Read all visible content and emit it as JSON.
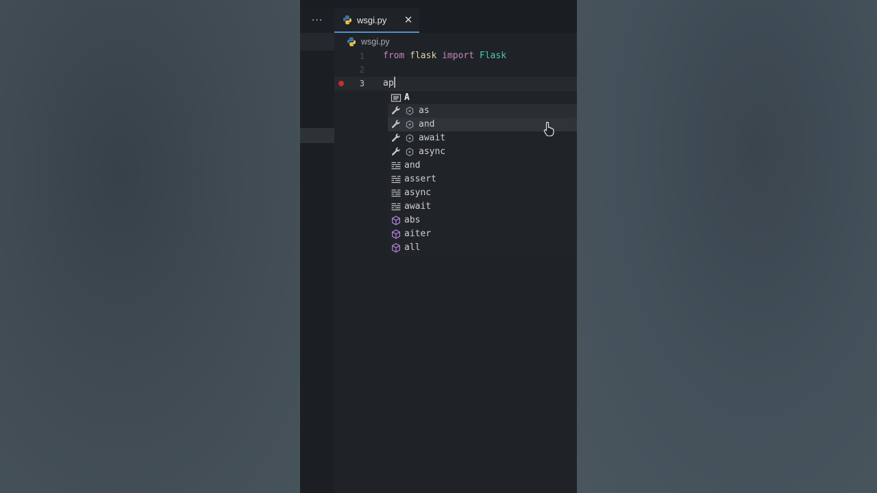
{
  "window": {
    "overflow_dots": "···"
  },
  "tabs": [
    {
      "label": "wsgi.py",
      "icon": "python-icon",
      "active": true,
      "close": "✕"
    }
  ],
  "breadcrumb": {
    "file": "wsgi.py",
    "icon": "python-icon"
  },
  "editor": {
    "lines": [
      {
        "number": "1",
        "tokens": [
          {
            "text": "from",
            "kind": "keyword"
          },
          {
            "text": " ",
            "kind": "plain"
          },
          {
            "text": "flask",
            "kind": "module"
          },
          {
            "text": " ",
            "kind": "plain"
          },
          {
            "text": "import",
            "kind": "keyword"
          },
          {
            "text": " ",
            "kind": "plain"
          },
          {
            "text": "Flask",
            "kind": "class"
          }
        ]
      },
      {
        "number": "2",
        "tokens": []
      },
      {
        "number": "3",
        "tokens": [
          {
            "text": "ap",
            "kind": "plain"
          }
        ],
        "breakpoint": true,
        "current": true
      }
    ]
  },
  "suggestions": [
    {
      "label": "A",
      "icon": "text-icon",
      "kind": "text"
    },
    {
      "label": "as",
      "icon": "wrench-icon",
      "kind": "snippet-keyword",
      "state": "focused"
    },
    {
      "label": "and",
      "icon": "wrench-icon",
      "kind": "snippet-keyword",
      "state": "hovered"
    },
    {
      "label": "await",
      "icon": "wrench-icon",
      "kind": "snippet-keyword"
    },
    {
      "label": "async",
      "icon": "wrench-icon",
      "kind": "snippet-keyword"
    },
    {
      "label": "and",
      "icon": "keyword-icon",
      "kind": "keyword"
    },
    {
      "label": "assert",
      "icon": "keyword-icon",
      "kind": "keyword"
    },
    {
      "label": "async",
      "icon": "keyword-icon",
      "kind": "keyword"
    },
    {
      "label": "await",
      "icon": "keyword-icon",
      "kind": "keyword"
    },
    {
      "label": "abs",
      "icon": "cube-icon",
      "kind": "function"
    },
    {
      "label": "aiter",
      "icon": "cube-icon",
      "kind": "function"
    },
    {
      "label": "all",
      "icon": "cube-icon",
      "kind": "function"
    }
  ],
  "colors": {
    "keyword": "#c586c0",
    "module": "#ddd7a8",
    "class": "#4ec9b0",
    "breakpoint": "#c72e2e",
    "tab_accent": "#4e94ce",
    "cube": "#b180d7"
  }
}
